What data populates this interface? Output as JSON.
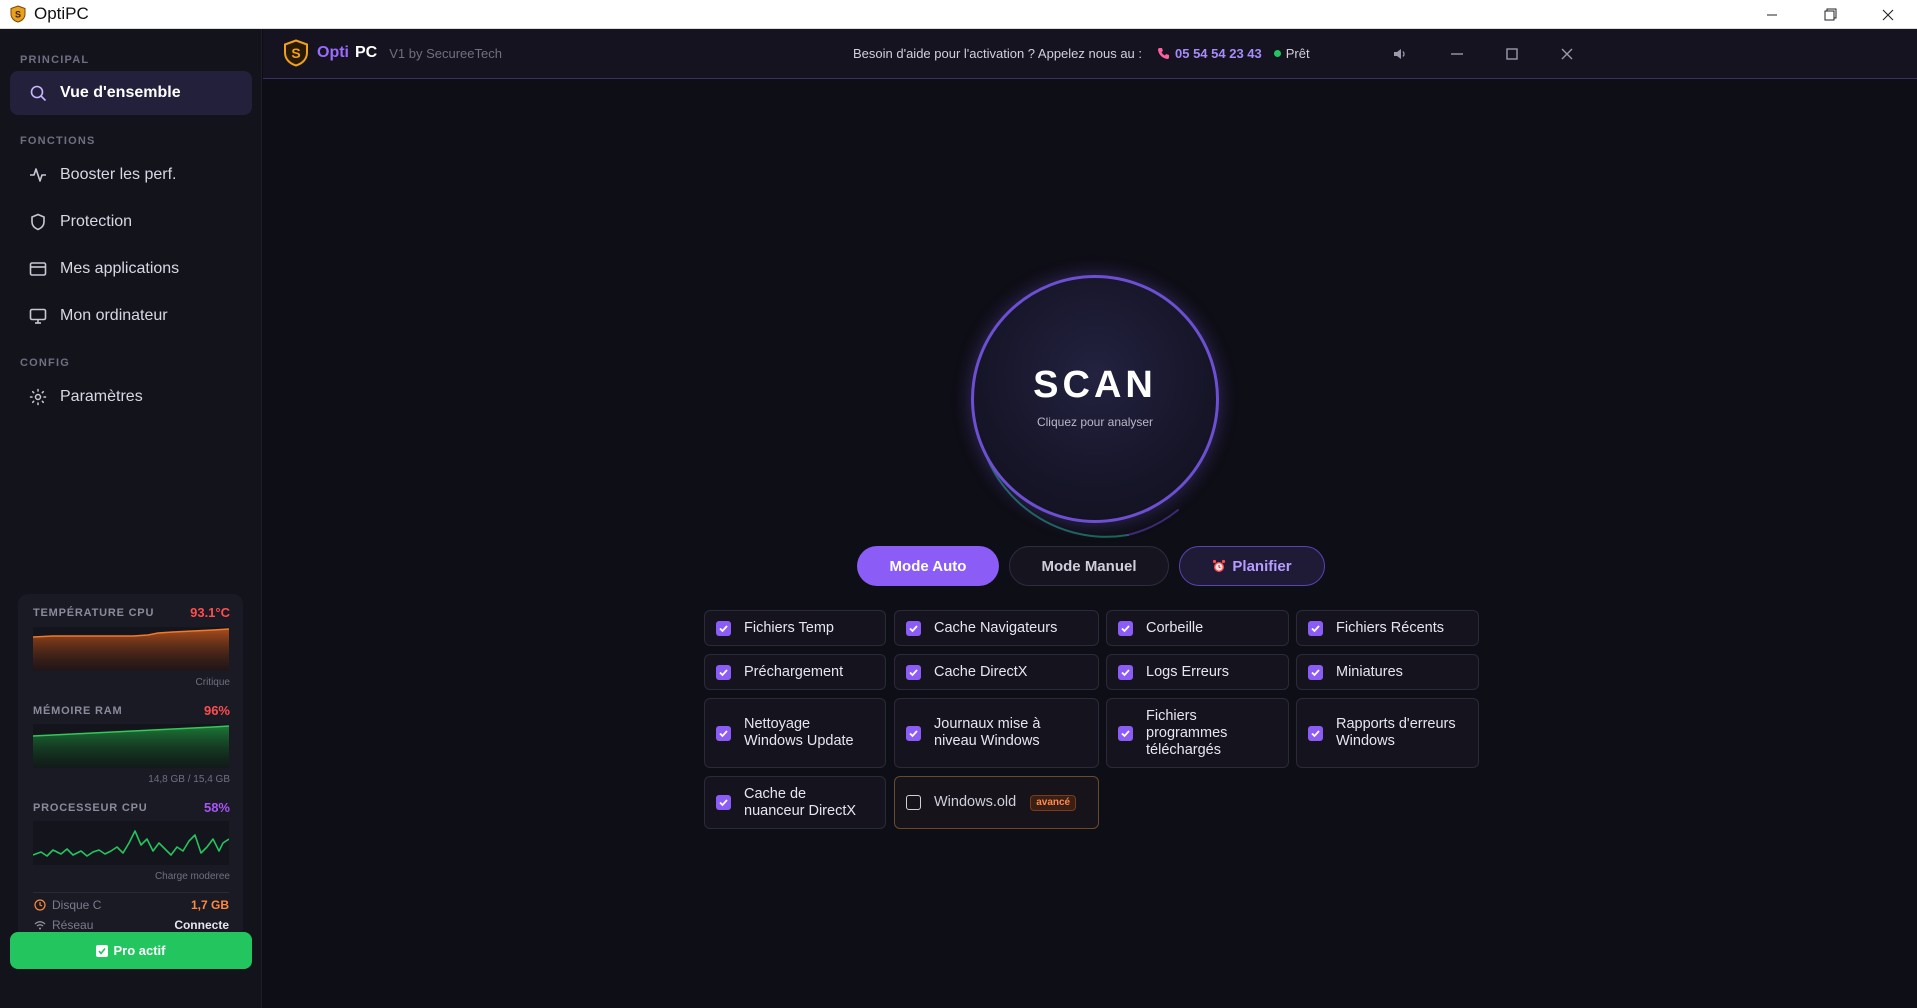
{
  "os": {
    "title": "OptiPC"
  },
  "sidebar": {
    "sections": {
      "principal": "PRINCIPAL",
      "fonctions": "FONCTIONS",
      "config": "CONFIG"
    },
    "items": [
      {
        "label": "Vue d'ensemble",
        "icon": "search-icon",
        "active": true
      },
      {
        "label": "Booster les perf.",
        "icon": "activity-icon"
      },
      {
        "label": "Protection",
        "icon": "shield-icon"
      },
      {
        "label": "Mes applications",
        "icon": "window-icon"
      },
      {
        "label": "Mon ordinateur",
        "icon": "monitor-icon"
      },
      {
        "label": "Paramètres",
        "icon": "gear-icon"
      }
    ],
    "stats": {
      "cpu_temp": {
        "label": "TEMPÉRATURE CPU",
        "value": "93.1°C",
        "sub": "Critique",
        "color": "#ff4d4f"
      },
      "ram": {
        "label": "MÉMOIRE RAM",
        "value": "96%",
        "sub": "14,8 GB / 15,4 GB",
        "color": "#ff4d4f"
      },
      "cpu": {
        "label": "PROCESSEUR CPU",
        "value": "58%",
        "sub": "Charge moderee",
        "color": "#a855f7"
      },
      "disk": {
        "label": "Disque C",
        "value": "1,7 GB",
        "color": "#ff8a3c"
      },
      "network": {
        "label": "Réseau",
        "value": "Connecte"
      }
    },
    "pro_button": "Pro actif"
  },
  "header": {
    "brand_opti": "Opti",
    "brand_pc": "PC",
    "version": "V1 by SecureeTech",
    "help_text": "Besoin d'aide pour l'activation ? Appelez nous au :",
    "phone": "05 54 54 23 43",
    "status": "Prêt"
  },
  "scan": {
    "title": "SCAN",
    "subtitle": "Cliquez pour analyser"
  },
  "modes": {
    "auto": "Mode Auto",
    "manual": "Mode Manuel",
    "plan": "Planifier"
  },
  "options": [
    {
      "label": "Fichiers Temp",
      "checked": true
    },
    {
      "label": "Cache Navigateurs",
      "checked": true
    },
    {
      "label": "Corbeille",
      "checked": true
    },
    {
      "label": "Fichiers Récents",
      "checked": true
    },
    {
      "label": "Préchargement",
      "checked": true
    },
    {
      "label": "Cache DirectX",
      "checked": true
    },
    {
      "label": "Logs Erreurs",
      "checked": true
    },
    {
      "label": "Miniatures",
      "checked": true
    },
    {
      "label": "Nettoyage Windows Update",
      "checked": true
    },
    {
      "label": "Journaux mise à niveau Windows",
      "checked": true
    },
    {
      "label": "Fichiers programmes téléchargés",
      "checked": true
    },
    {
      "label": "Rapports d'erreurs Windows",
      "checked": true
    },
    {
      "label": "Cache de nuanceur DirectX",
      "checked": true
    },
    {
      "label": "Windows.old",
      "checked": false,
      "badge": "avancé"
    }
  ]
}
